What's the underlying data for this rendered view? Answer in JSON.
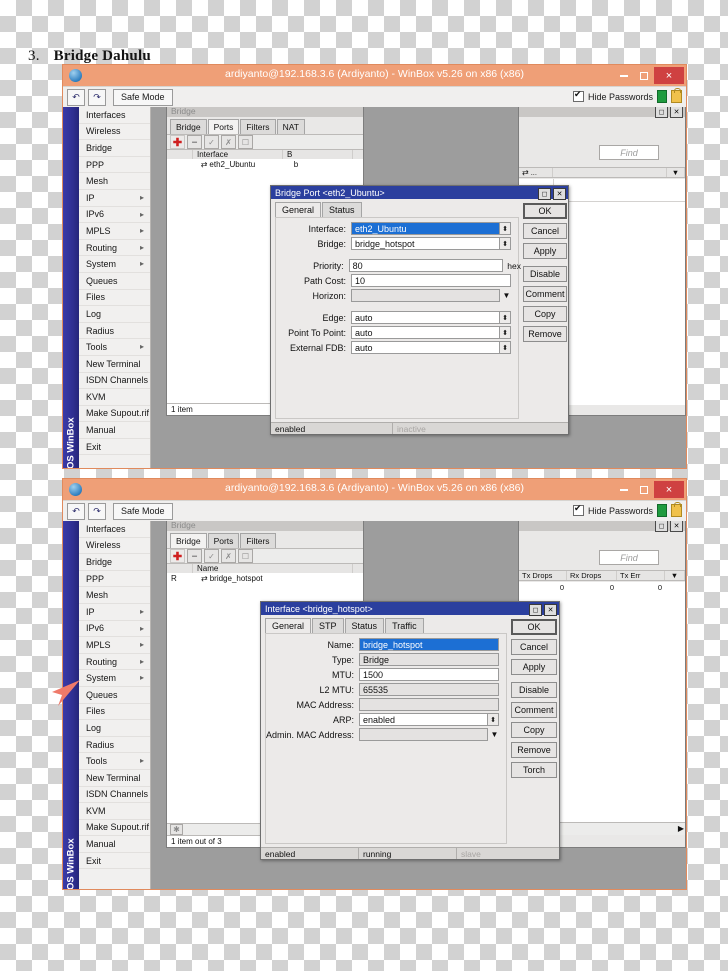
{
  "page": {
    "heading_number": "3.",
    "heading_text": "Bridge Dahulu"
  },
  "window_title": "ardiyanto@192.168.3.6 (Ardiyanto) - WinBox v5.26 on x86 (x86)",
  "toolbar": {
    "undo_icon": "undo-icon",
    "redo_icon": "redo-icon",
    "safe_mode_label": "Safe Mode",
    "hide_passwords_label": "Hide Passwords",
    "hide_passwords_checked": true
  },
  "window_controls": {
    "minimize": "–",
    "maximize": "□",
    "close": "×"
  },
  "sidebar": {
    "rail_label": "RouterOS WinBox",
    "items": [
      {
        "label": "Interfaces",
        "submenu": false
      },
      {
        "label": "Wireless",
        "submenu": false
      },
      {
        "label": "Bridge",
        "submenu": false
      },
      {
        "label": "PPP",
        "submenu": false
      },
      {
        "label": "Mesh",
        "submenu": false
      },
      {
        "label": "IP",
        "submenu": true
      },
      {
        "label": "IPv6",
        "submenu": true
      },
      {
        "label": "MPLS",
        "submenu": true
      },
      {
        "label": "Routing",
        "submenu": true
      },
      {
        "label": "System",
        "submenu": true
      },
      {
        "label": "Queues",
        "submenu": false
      },
      {
        "label": "Files",
        "submenu": false
      },
      {
        "label": "Log",
        "submenu": false
      },
      {
        "label": "Radius",
        "submenu": false
      },
      {
        "label": "Tools",
        "submenu": true
      },
      {
        "label": "New Terminal",
        "submenu": false
      },
      {
        "label": "ISDN Channels",
        "submenu": false
      },
      {
        "label": "KVM",
        "submenu": false
      },
      {
        "label": "Make Supout.rif",
        "submenu": false
      },
      {
        "label": "Manual",
        "submenu": false
      },
      {
        "label": "Exit",
        "submenu": false
      }
    ]
  },
  "window1": {
    "bridge_window": {
      "title": "Bridge",
      "tabs": [
        "Bridge",
        "Ports",
        "Filters",
        "NAT"
      ],
      "active_tab": "Ports",
      "toolbar_icons": [
        "add-icon",
        "remove-icon",
        "enable-icon",
        "disable-icon",
        "comment-icon"
      ],
      "columns": [
        "Interface",
        "B"
      ],
      "rows": [
        {
          "interface": "eth2_Ubuntu",
          "bridge": "b"
        }
      ],
      "status": "1 item"
    },
    "right_panel": {
      "find_placeholder": "Find",
      "column_partial": "...",
      "filter_icon": "filter-dropdown-icon"
    },
    "dialog": {
      "title": "Bridge Port <eth2_Ubuntu>",
      "tabs": [
        "General",
        "Status"
      ],
      "active_tab": "General",
      "fields": [
        {
          "label": "Interface:",
          "value": "eth2_Ubuntu",
          "selected": true,
          "spinner": true
        },
        {
          "label": "Bridge:",
          "value": "bridge_hotspot",
          "spinner": true
        },
        {
          "label": "Priority:",
          "value": "80",
          "suffix": "hex"
        },
        {
          "label": "Path Cost:",
          "value": "10"
        },
        {
          "label": "Horizon:",
          "value": "",
          "readonly": true,
          "caret": true
        },
        {
          "label": "Edge:",
          "value": "auto",
          "spinner": true
        },
        {
          "label": "Point To Point:",
          "value": "auto",
          "spinner": true
        },
        {
          "label": "External FDB:",
          "value": "auto",
          "spinner": true
        }
      ],
      "buttons": [
        "OK",
        "Cancel",
        "Apply",
        "Disable",
        "Comment",
        "Copy",
        "Remove"
      ],
      "status_left": "enabled",
      "status_right": "inactive"
    }
  },
  "window2": {
    "bridge_window": {
      "title": "Bridge",
      "tabs": [
        "Bridge",
        "Ports",
        "Filters"
      ],
      "active_tab": "Bridge",
      "toolbar_icons": [
        "add-icon",
        "remove-icon",
        "enable-icon",
        "disable-icon",
        "comment-icon"
      ],
      "columns": [
        "Name"
      ],
      "rows": [
        {
          "flag": "R",
          "name": "bridge_hotspot"
        }
      ],
      "status": "1 item out of 3"
    },
    "right_panel": {
      "find_placeholder": "Find",
      "columns": [
        "Tx Drops",
        "Rx Drops",
        "Tx Err"
      ],
      "values": [
        "0",
        "0",
        "0"
      ]
    },
    "dialog": {
      "title": "Interface <bridge_hotspot>",
      "tabs": [
        "General",
        "STP",
        "Status",
        "Traffic"
      ],
      "active_tab": "General",
      "fields": [
        {
          "label": "Name:",
          "value": "bridge_hotspot",
          "selected": true
        },
        {
          "label": "Type:",
          "value": "Bridge",
          "readonly": true
        },
        {
          "label": "MTU:",
          "value": "1500"
        },
        {
          "label": "L2 MTU:",
          "value": "65535",
          "readonly": true
        },
        {
          "label": "MAC Address:",
          "value": "",
          "readonly": true
        },
        {
          "label": "ARP:",
          "value": "enabled",
          "spinner": true
        },
        {
          "label": "Admin. MAC Address:",
          "value": "",
          "readonly": true,
          "caret": true
        }
      ],
      "buttons": [
        "OK",
        "Cancel",
        "Apply",
        "Disable",
        "Comment",
        "Copy",
        "Remove",
        "Torch"
      ],
      "status_left": "enabled",
      "status_mid": "running",
      "status_right": "slave"
    }
  },
  "colors": {
    "titlebar": "#ef9f77",
    "close_button": "#cf4141",
    "dialog_titlebar": "#2b3f9e",
    "rail": "#2f2f92",
    "selection": "#1c6fd4",
    "annotation_arrow": "#ef7a6a"
  }
}
